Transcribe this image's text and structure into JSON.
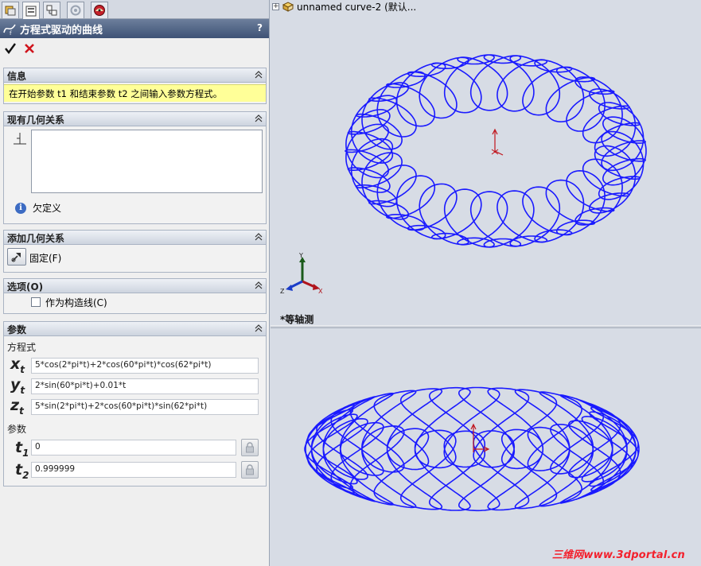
{
  "tabs": [
    {
      "icon": "feature-manager-icon"
    },
    {
      "icon": "property-manager-icon",
      "active": true
    },
    {
      "icon": "configuration-manager-icon"
    },
    {
      "icon": "dimxpert-icon"
    },
    {
      "icon": "display-manager-icon"
    }
  ],
  "panel": {
    "title": "方程式驱动的曲线",
    "help": "?",
    "ok_icon": "checkmark-icon",
    "cancel_icon": "close-icon"
  },
  "info": {
    "header": "信息",
    "message": "在开始参数 t1 和结束参数 t2 之间输入参数方程式。"
  },
  "existing_relations": {
    "header": "现有几何关系",
    "items": [],
    "status": "欠定义"
  },
  "add_relations": {
    "header": "添加几何关系",
    "fix_label": "固定(F)"
  },
  "options": {
    "header": "选项(O)",
    "construction_label": "作为构造线(C)",
    "construction_checked": false
  },
  "parameters": {
    "header": "参数",
    "equation_label": "方程式",
    "x_var": "x",
    "y_var": "y",
    "z_var": "z",
    "sub_t": "t",
    "xt": "5*cos(2*pi*t)+2*cos(60*pi*t)*cos(62*pi*t)",
    "yt": "2*sin(60*pi*t)+0.01*t",
    "zt": "5*sin(2*pi*t)+2*cos(60*pi*t)*sin(62*pi*t)",
    "param_label": "参数",
    "t_var": "t",
    "t1_sub": "1",
    "t2_sub": "2",
    "t1": "0",
    "t2": "0.999999"
  },
  "viewport": {
    "tree_item": "unnamed curve-2  (默认...",
    "view_name": "*等轴测",
    "triad_labels": {
      "x": "X",
      "y": "Y",
      "z": "Z"
    },
    "curve_color": "#1a1aff"
  },
  "watermark": "三维网www.3dportal.cn"
}
